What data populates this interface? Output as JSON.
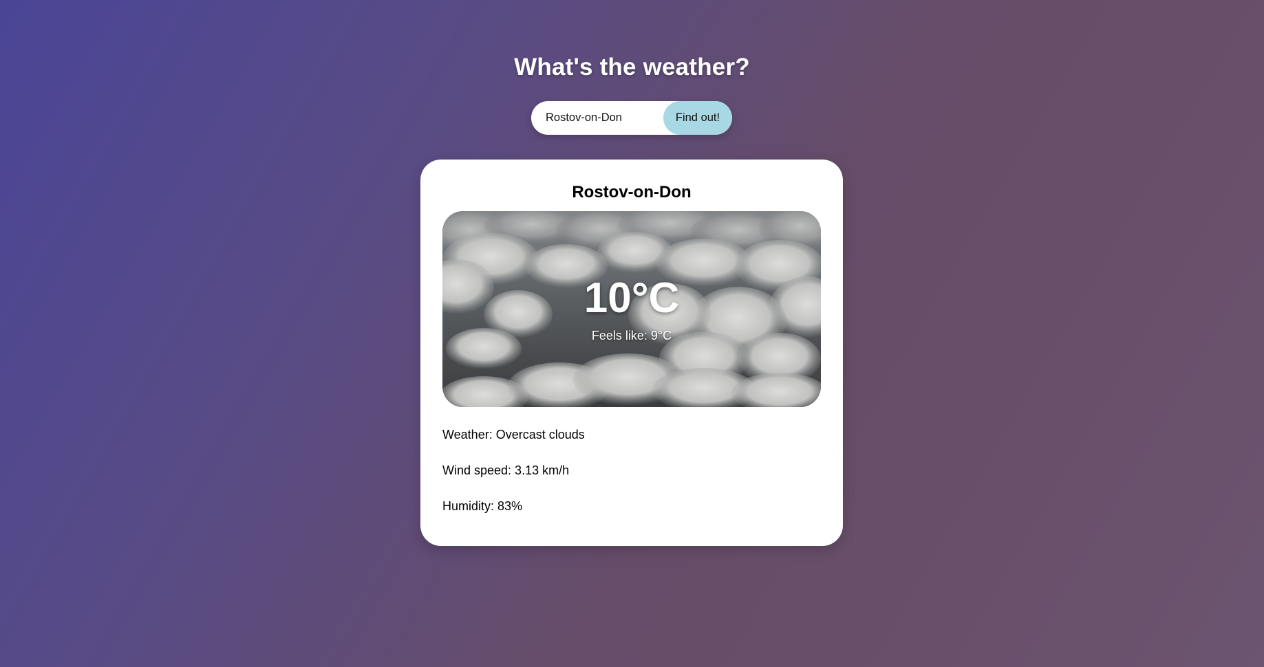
{
  "header": {
    "title": "What's the weather?"
  },
  "search": {
    "value": "Rostov-on-Don",
    "button_label": "Find out!"
  },
  "weather_card": {
    "city": "Rostov-on-Don",
    "temperature": "10°C",
    "feels_like": "Feels like: 9°C",
    "weather": "Weather: Overcast clouds",
    "wind_speed": "Wind speed: 3.13 km/h",
    "humidity": "Humidity: 83%"
  },
  "image": {
    "description_icon": "overcast-clouds-photo"
  },
  "colors": {
    "button_bg": "#a8d8e3",
    "card_bg": "#ffffff",
    "title_text": "#ffffff"
  }
}
